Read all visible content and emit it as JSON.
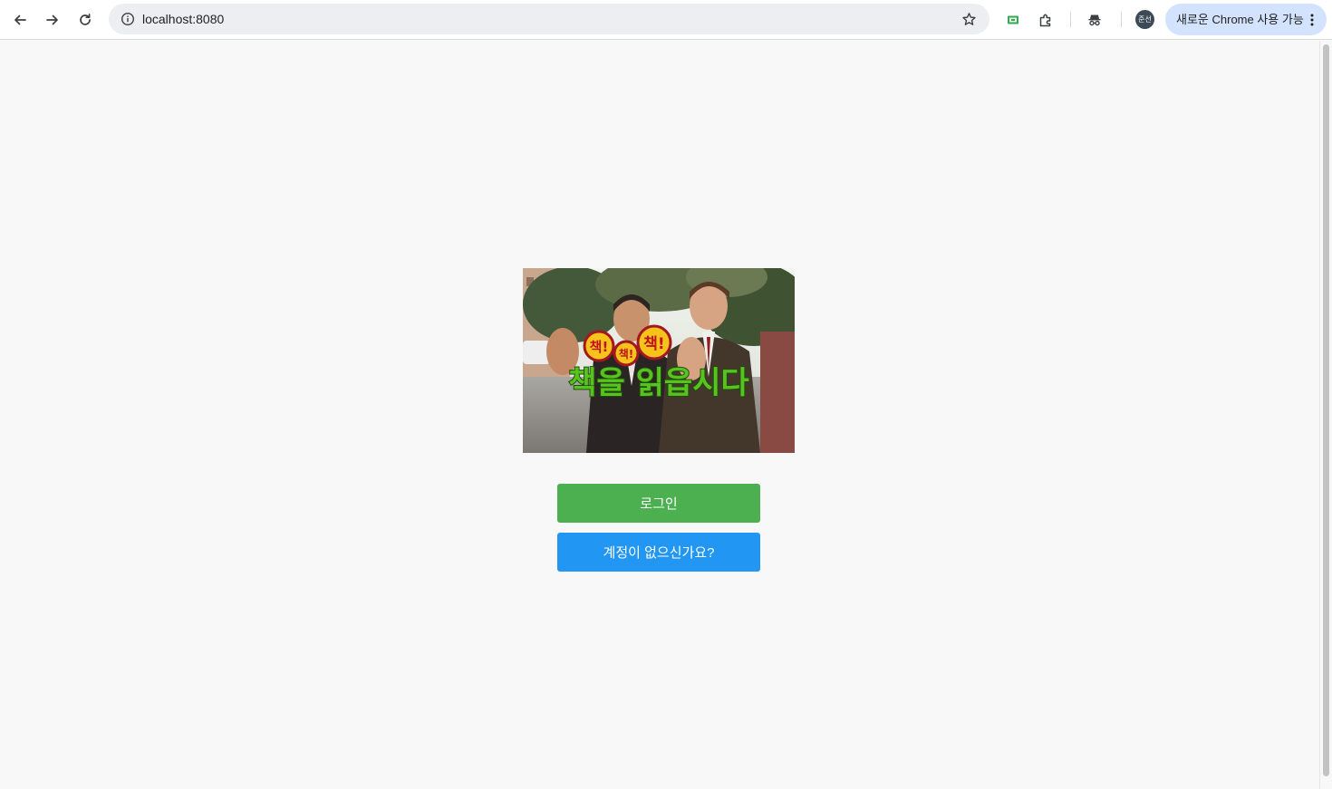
{
  "browser": {
    "url": "localhost:8080",
    "profile_initials": "준선",
    "update_label": "새로운 Chrome 사용 가능"
  },
  "hero": {
    "badges": [
      "책!",
      "책!",
      "책!"
    ],
    "caption": "책을 읽읍시다"
  },
  "actions": {
    "login_label": "로그인",
    "signup_label": "계정이 없으신가요?"
  },
  "colors": {
    "login": "#4caf50",
    "signup": "#2196f3",
    "background": "#f8f8f8"
  }
}
